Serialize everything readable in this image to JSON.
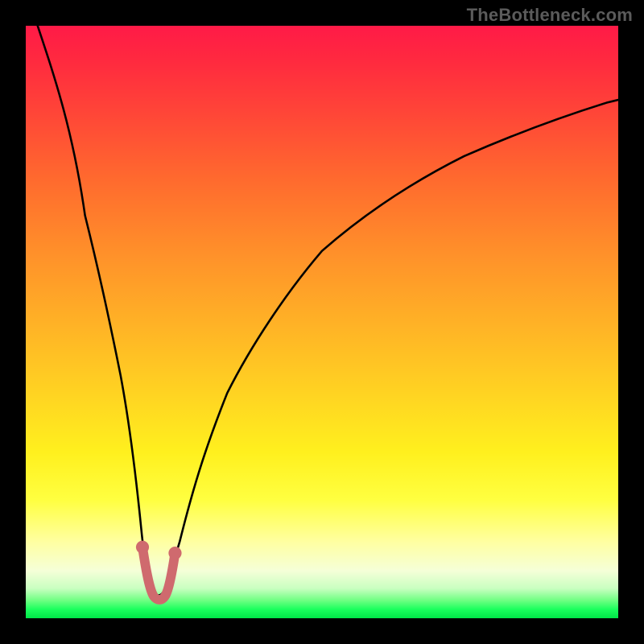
{
  "watermark": "TheBottleneck.com",
  "chart_data": {
    "type": "line",
    "title": "",
    "xlabel": "",
    "ylabel": "",
    "xlim": [
      0,
      100
    ],
    "ylim": [
      0,
      100
    ],
    "grid": false,
    "legend": false,
    "note": "Axes are unlabeled; values are estimated by visual position as percentages of plot width/height. Curve depicts deviation from an optimum: steep drop from top-left to a minimum near x≈22, then a broad rise toward the right.",
    "series": [
      {
        "name": "bottleneck-curve",
        "color": "#000000",
        "x": [
          2,
          4,
          6,
          8,
          10,
          12,
          14,
          16,
          18,
          19.5,
          20.5,
          21.5,
          22.5,
          23.5,
          24.5,
          26,
          28,
          30,
          34,
          38,
          44,
          50,
          58,
          66,
          74,
          82,
          90,
          98,
          100
        ],
        "y": [
          100,
          92,
          84,
          76,
          68,
          60,
          51,
          41,
          30,
          20,
          12,
          6,
          3.5,
          4,
          7,
          13,
          21,
          28,
          38,
          46,
          55,
          62,
          69,
          74,
          78,
          81.5,
          84.5,
          87,
          87.5
        ]
      },
      {
        "name": "highlighted-optimum",
        "color": "#d46a6a",
        "shape": "u-segment",
        "x": [
          19.5,
          20.5,
          21.5,
          22.5,
          23.5,
          24.5
        ],
        "y": [
          12,
          7,
          4,
          3.5,
          6,
          11
        ]
      }
    ],
    "background_gradient": {
      "orientation": "vertical",
      "stops": [
        {
          "pos": 0.0,
          "color": "#ff1a47"
        },
        {
          "pos": 0.14,
          "color": "#ff4338"
        },
        {
          "pos": 0.38,
          "color": "#ff8f2a"
        },
        {
          "pos": 0.62,
          "color": "#ffd322"
        },
        {
          "pos": 0.8,
          "color": "#ffff40"
        },
        {
          "pos": 0.92,
          "color": "#f5ffd8"
        },
        {
          "pos": 0.97,
          "color": "#6eff82"
        },
        {
          "pos": 1.0,
          "color": "#00e648"
        }
      ]
    }
  }
}
